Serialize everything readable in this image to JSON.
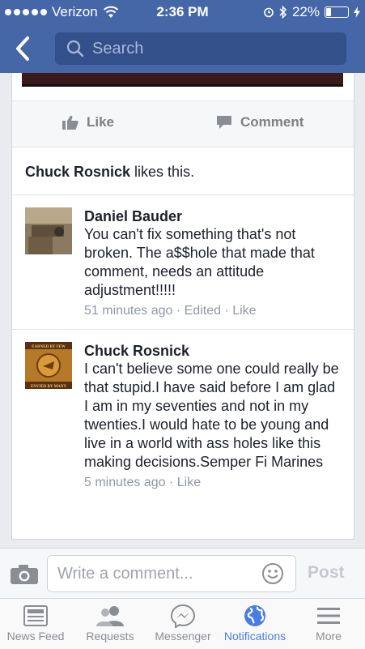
{
  "status_bar": {
    "carrier": "Verizon",
    "time": "2:36 PM",
    "battery_percent": "22%",
    "battery_level": 0.22
  },
  "nav": {
    "search_placeholder": "Search"
  },
  "post_actions": {
    "like_label": "Like",
    "comment_label": "Comment"
  },
  "likes_summary": {
    "name": "Chuck Rosnick",
    "suffix": " likes this."
  },
  "comments": [
    {
      "author": "Daniel Bauder",
      "text": "You can't fix something that's not broken. The a$$hole that made that comment, needs an attitude adjustment!!!!!",
      "time": "51 minutes ago",
      "edited": "Edited",
      "like": "Like"
    },
    {
      "author": "Chuck Rosnick",
      "text": "I can't believe some one could really be that stupid.I have said before I am glad I am in my seventies and not in my twenties.I would hate to be young and live in a world with ass holes like this making decisions.Semper Fi Marines",
      "time": "5 minutes ago",
      "like": "Like",
      "avatar_text_top": "EARNED BY FEW",
      "avatar_text_bottom": "ENVIED BY MANY"
    }
  ],
  "composer": {
    "placeholder": "Write a comment...",
    "post_label": "Post"
  },
  "tabs": [
    {
      "label": "News Feed",
      "icon": "news-feed-icon"
    },
    {
      "label": "Requests",
      "icon": "friend-requests-icon"
    },
    {
      "label": "Messenger",
      "icon": "messenger-icon"
    },
    {
      "label": "Notifications",
      "icon": "globe-icon",
      "active": true
    },
    {
      "label": "More",
      "icon": "menu-icon"
    }
  ],
  "colors": {
    "brand": "#4567a8",
    "active_tab": "#4a7de2",
    "meta_text": "#9197a3"
  }
}
